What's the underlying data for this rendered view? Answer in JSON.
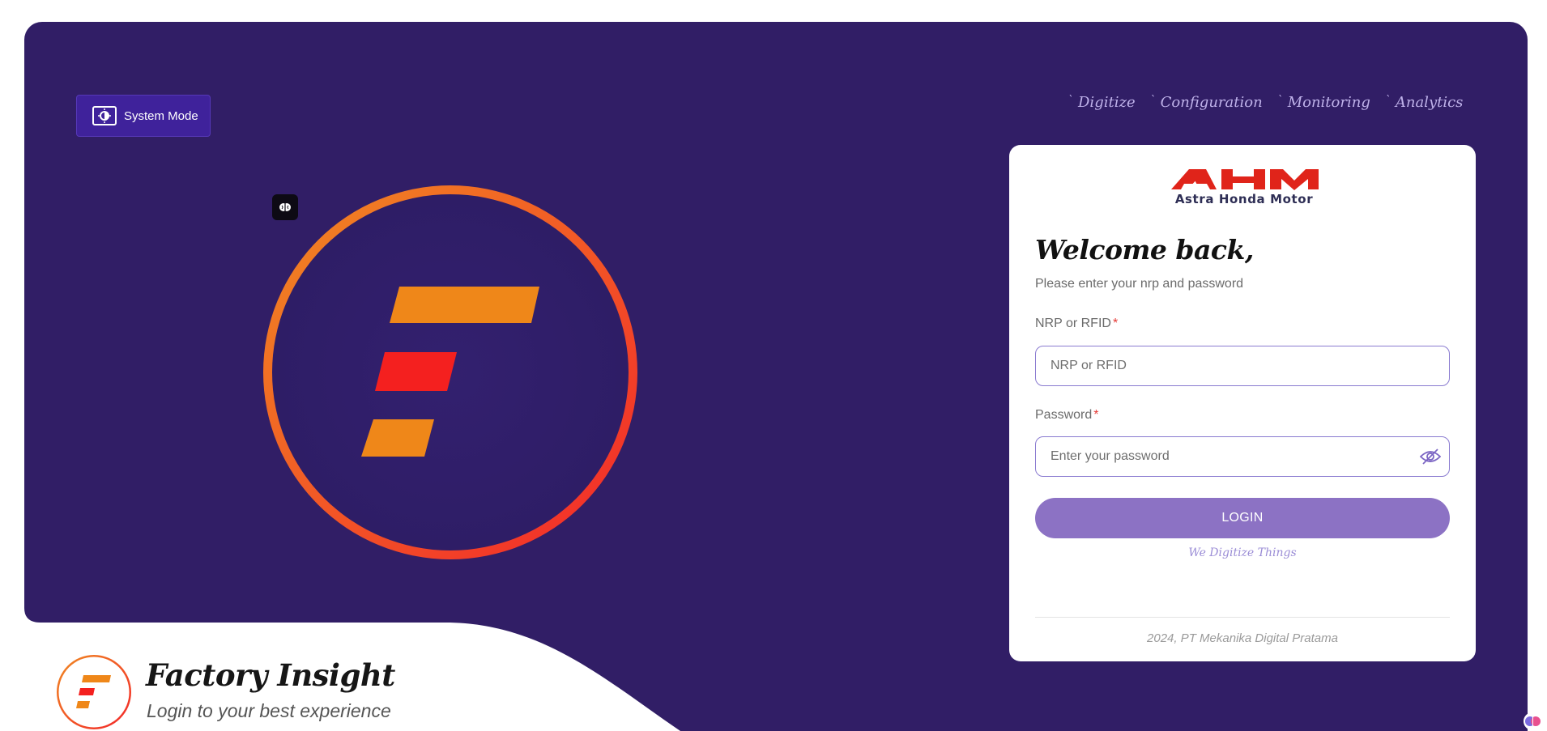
{
  "system_mode": {
    "label": "System Mode",
    "icon": "brightness-toggle-icon"
  },
  "nav": {
    "items": [
      {
        "label": "Digitize"
      },
      {
        "label": "Configuration"
      },
      {
        "label": "Monitoring"
      },
      {
        "label": "Analytics"
      }
    ]
  },
  "brand": {
    "logo_text": "AHM",
    "name": "Astra Honda Motor",
    "color": "#e0241a"
  },
  "login": {
    "welcome": "Welcome back,",
    "subtitle": "Please enter your nrp and password",
    "nrp_label": "NRP or RFID",
    "nrp_placeholder": "NRP or RFID",
    "nrp_value": "",
    "password_label": "Password",
    "password_placeholder": "Enter your password",
    "password_value": "",
    "required_mark": "*",
    "button": "LOGIN",
    "tagline": "We Digitize Things",
    "footer": "2024, PT Mekanika Digital Pratama"
  },
  "app": {
    "title": "Factory Insight",
    "subtitle": "Login to your best experience"
  },
  "colors": {
    "hero_bg": "#311e66",
    "accent_orange": "#ee8619",
    "accent_red": "#f4201f",
    "button": "#8c72c4"
  }
}
